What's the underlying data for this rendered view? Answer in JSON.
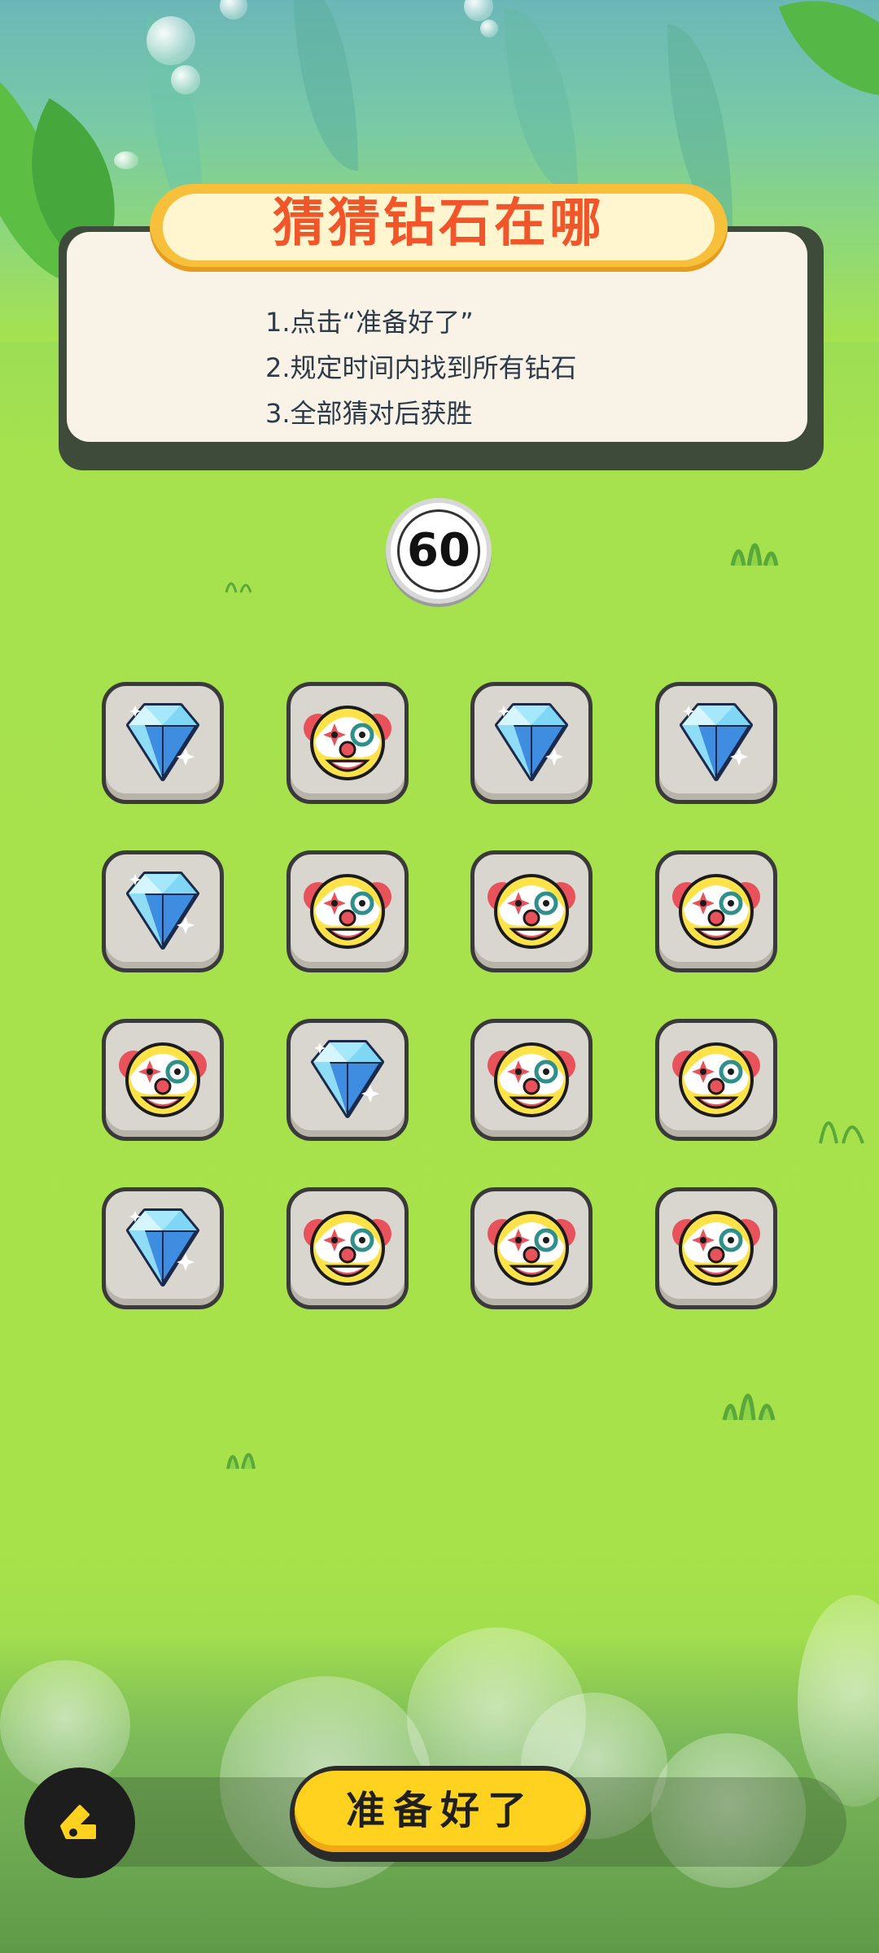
{
  "game": {
    "title": "猜猜钻石在哪",
    "rules": [
      "1.点击“准备好了”",
      "2.规定时间内找到所有钻石",
      "3.全部猜对后获胜"
    ],
    "timer": "60",
    "ready_button_label": "准备好了"
  },
  "grid": {
    "rows": 4,
    "columns": 4,
    "tiles": [
      [
        "diamond",
        "clown",
        "diamond",
        "diamond"
      ],
      [
        "diamond",
        "clown",
        "clown",
        "clown"
      ],
      [
        "clown",
        "diamond",
        "clown",
        "clown"
      ],
      [
        "diamond",
        "clown",
        "clown",
        "clown"
      ]
    ]
  },
  "colors": {
    "grass": "#a6e24e",
    "title_text": "#f0562a",
    "title_banner": "#f7c03a",
    "card_bg": "#f8f3e6",
    "tile_bg": "#d9d6cf",
    "button": "#ffd21f"
  },
  "icons": {
    "diamond": "diamond-icon",
    "clown": "clown-face-icon",
    "logo": "app-logo-icon"
  }
}
